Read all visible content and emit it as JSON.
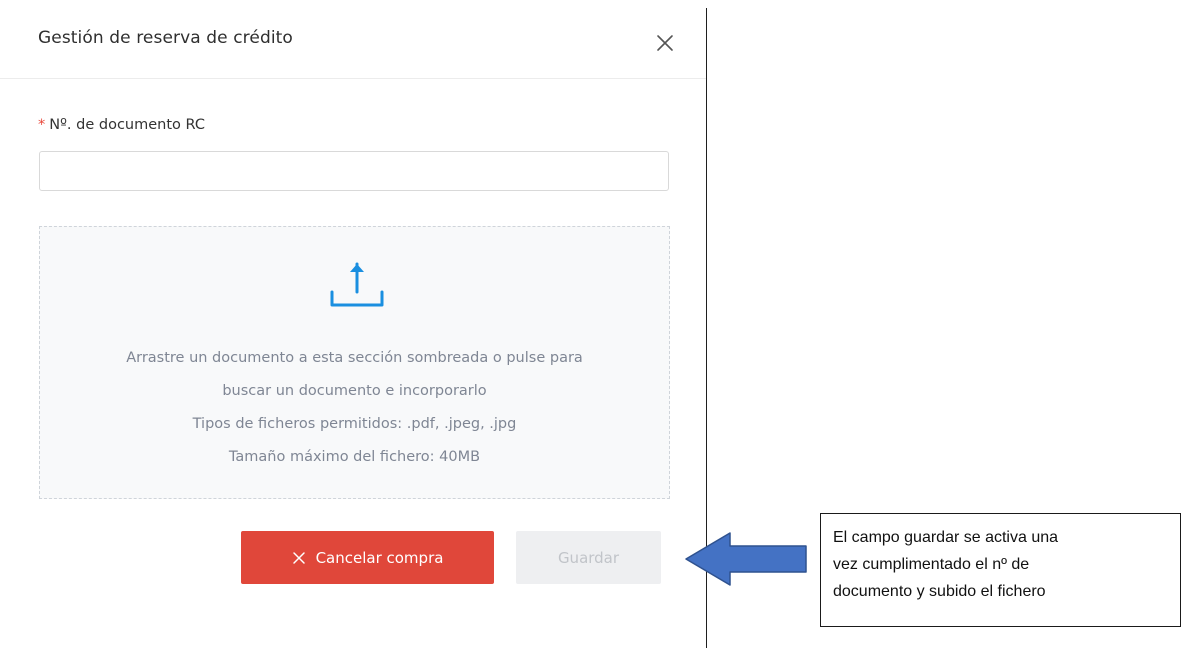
{
  "modal": {
    "title": "Gestión de reserva de crédito",
    "close_icon": "close-icon"
  },
  "form": {
    "required_mark": "*",
    "doc_label": "Nº. de documento RC",
    "doc_value": "",
    "doc_placeholder": ""
  },
  "dropzone": {
    "icon": "upload-icon",
    "line1": "Arrastre un documento a esta sección sombreada o pulse para",
    "line2": "buscar un documento e incorporarlo",
    "line3": "Tipos de ficheros permitidos: .pdf, .jpeg, .jpg",
    "line4": "Tamaño máximo del fichero: 40MB"
  },
  "actions": {
    "cancel_label": "Cancelar compra",
    "save_label": "Guardar",
    "save_enabled": false
  },
  "annotation": {
    "line1": "El campo guardar se activa una",
    "line2": "vez cumplimentado el nº de",
    "line3": "documento y subido el fichero"
  },
  "colors": {
    "accent": "#1a8fe0",
    "cancel": "#e0473a",
    "arrow": "#4472c4",
    "required": "#e8483b"
  }
}
